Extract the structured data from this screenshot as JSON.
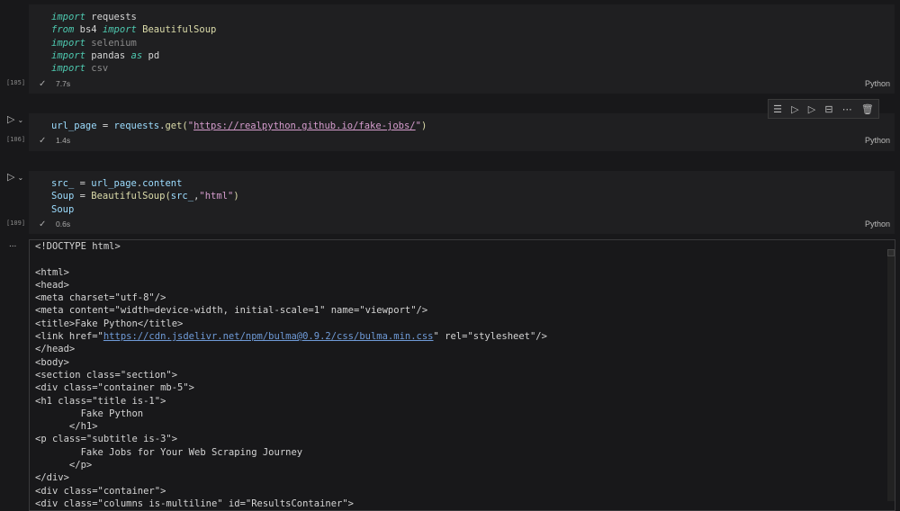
{
  "cells": [
    {
      "count": "[105]",
      "time": "7.7s",
      "lang": "Python",
      "lines": [
        [
          [
            "kw",
            "import"
          ],
          [
            "mod",
            " requests"
          ]
        ],
        [
          [
            "kw",
            "from"
          ],
          [
            "mod",
            " bs4 "
          ],
          [
            "kw",
            "import"
          ],
          [
            "cls",
            " BeautifulSoup"
          ]
        ],
        [
          [
            "kw",
            "import"
          ],
          [
            "dim",
            " selenium"
          ]
        ],
        [
          [
            "kw",
            "import"
          ],
          [
            "mod",
            " pandas "
          ],
          [
            "kw",
            "as"
          ],
          [
            "mod",
            " pd"
          ]
        ],
        [
          [
            "kw",
            "import"
          ],
          [
            "dim",
            " csv"
          ]
        ]
      ]
    },
    {
      "count": "[106]",
      "time": "1.4s",
      "lang": "Python",
      "lines": [
        [
          [
            "var",
            "url_page"
          ],
          [
            "mod",
            " = "
          ],
          [
            "var",
            "requests"
          ],
          [
            "mod",
            "."
          ],
          [
            "fn",
            "get"
          ],
          [
            "cls",
            "("
          ],
          [
            "str",
            "\""
          ],
          [
            "str url",
            "https://realpython.github.io/fake-jobs/"
          ],
          [
            "str",
            "\""
          ],
          [
            "cls",
            ")"
          ]
        ]
      ]
    },
    {
      "count": "[109]",
      "time": "0.6s",
      "lang": "Python",
      "lines": [
        [
          [
            "var",
            "src_"
          ],
          [
            "mod",
            " = "
          ],
          [
            "var",
            "url_page"
          ],
          [
            "mod",
            "."
          ],
          [
            "var",
            "content"
          ]
        ],
        [
          [
            "var",
            "Soup"
          ],
          [
            "mod",
            " = "
          ],
          [
            "cls",
            "BeautifulSoup"
          ],
          [
            "cls",
            "("
          ],
          [
            "var",
            "src_"
          ],
          [
            "mod",
            ","
          ],
          [
            "str",
            "\"html\""
          ],
          [
            "cls",
            ")"
          ]
        ],
        [
          [
            "var",
            "Soup"
          ]
        ]
      ]
    }
  ],
  "toolbar": {
    "icons": [
      "run-by-line-icon",
      "execute-above-icon",
      "execute-below-icon",
      "split-cell-icon",
      "more-icon",
      "delete-icon"
    ],
    "glyphs": [
      "☰",
      "▷",
      "▷",
      "⊟",
      "⋯",
      "🗑"
    ]
  },
  "output": {
    "more": "...",
    "lines": [
      "<!DOCTYPE html>",
      "",
      "<html>",
      "<head>",
      "<meta charset=\"utf-8\"/>",
      "<meta content=\"width=device-width, initial-scale=1\" name=\"viewport\"/>",
      "<title>Fake Python</title>",
      {
        "pre": "<link href=\"",
        "link": "https://cdn.jsdelivr.net/npm/bulma@0.9.2/css/bulma.min.css",
        "post": "\" rel=\"stylesheet\"/>"
      },
      "</head>",
      "<body>",
      "<section class=\"section\">",
      "<div class=\"container mb-5\">",
      "<h1 class=\"title is-1\">",
      "        Fake Python",
      "      </h1>",
      "<p class=\"subtitle is-3\">",
      "        Fake Jobs for Your Web Scraping Journey",
      "      </p>",
      "</div>",
      "<div class=\"container\">",
      "<div class=\"columns is-multiline\" id=\"ResultsContainer\">"
    ]
  }
}
